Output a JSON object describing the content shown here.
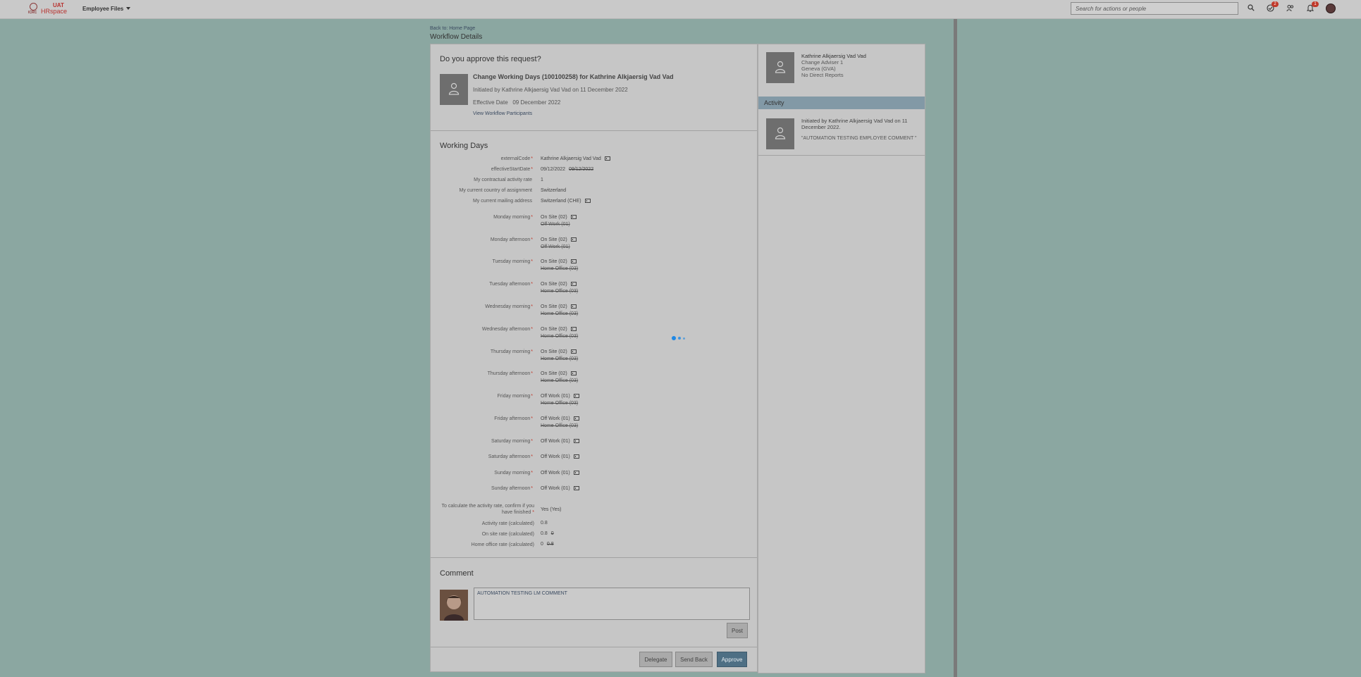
{
  "header": {
    "logo_uat": "UAT",
    "logo_hr": "HRspace",
    "logo_icrc": "ICRC",
    "module": "Employee Files",
    "search_placeholder": "Search for actions or people",
    "todo_badge": "2",
    "notif_badge": "1",
    "icons": [
      "search-icon",
      "todo-icon",
      "people-icon",
      "bell-icon",
      "avatar"
    ]
  },
  "nav": {
    "back": "Back to: Home Page",
    "page_title": "Workflow Details"
  },
  "request": {
    "question": "Do you approve this request?",
    "title": "Change Working Days (100100258) for Kathrine Alkjaersig Vad Vad",
    "initiated": "Initiated by Kathrine Alkjaersig Vad Vad on 11 December 2022",
    "effective_label": "Effective Date",
    "effective_date": "09 December 2022",
    "participants_link": "View Workflow Participants"
  },
  "working_days": {
    "section_title": "Working Days",
    "top_fields": [
      {
        "label": "externalCode",
        "required": "*",
        "value": "Kathrine Alkjaersig Vad Vad",
        "old": "",
        "history": true
      },
      {
        "label": "effectiveStartDate",
        "required": "*",
        "value": "09/12/2022",
        "old": "09/12/2022",
        "history": false
      },
      {
        "label": "My contractual activity rate",
        "required": "",
        "value": "1",
        "old": "",
        "history": false
      },
      {
        "label": "My current country of assignment",
        "required": "",
        "value": "Switzerland",
        "old": "",
        "history": false
      },
      {
        "label": "My current mailing address",
        "required": "",
        "value": "Switzerland (CHE)",
        "old": "",
        "history": true
      }
    ],
    "day_fields": [
      {
        "label": "Monday morning",
        "required": "*",
        "value": "On Site (02)",
        "old": "Off Work (01)"
      },
      {
        "label": "Monday afternoon",
        "required": "*",
        "value": "On Site (02)",
        "old": "Off Work (01)"
      },
      {
        "label": "Tuesday morning",
        "required": "*",
        "value": "On Site (02)",
        "old": "Home Office (03)"
      },
      {
        "label": "Tuesday afternoon",
        "required": "*",
        "value": "On Site (02)",
        "old": "Home Office (03)"
      },
      {
        "label": "Wednesday morning",
        "required": "*",
        "value": "On Site (02)",
        "old": "Home Office (03)"
      },
      {
        "label": "Wednesday afternoon",
        "required": "*",
        "value": "On Site (02)",
        "old": "Home Office (03)"
      },
      {
        "label": "Thursday morning",
        "required": "*",
        "value": "On Site (02)",
        "old": "Home Office (03)"
      },
      {
        "label": "Thursday afternoon",
        "required": "*",
        "value": "On Site (02)",
        "old": "Home Office (03)"
      },
      {
        "label": "Friday morning",
        "required": "*",
        "value": "Off Work (01)",
        "old": "Home Office (03)"
      },
      {
        "label": "Friday afternoon",
        "required": "*",
        "value": "Off Work (01)",
        "old": "Home Office (03)"
      }
    ],
    "weekend_fields": [
      {
        "label": "Saturday morning",
        "required": "*",
        "value": "Off Work (01)"
      },
      {
        "label": "Saturday afternoon",
        "required": "*",
        "value": "Off Work (01)"
      },
      {
        "label": "Sunday morning",
        "required": "*",
        "value": "Off Work (01)"
      },
      {
        "label": "Sunday afternoon",
        "required": "*",
        "value": "Off Work (01)"
      }
    ],
    "confirm_label": "To calculate the activity rate, confirm if you have finished",
    "confirm_required": "*",
    "confirm_value": "Yes (Yes)",
    "rates": [
      {
        "label": "Activity rate (calculated)",
        "value": "0.8",
        "old": ""
      },
      {
        "label": "On site rate (calculated)",
        "value": "0.8",
        "old": "0"
      },
      {
        "label": "Home office rate (calculated)",
        "value": "0",
        "old": "0.8"
      }
    ]
  },
  "comment": {
    "section_title": "Comment",
    "text": "AUTOMATION TESTING LM COMMENT",
    "post": "Post"
  },
  "actions": {
    "delegate": "Delegate",
    "send_back": "Send Back",
    "approve": "Approve"
  },
  "side": {
    "name": "Kathrine Alkjaersig Vad Vad",
    "role": "Change Adviser 1",
    "location": "Geneva (GVA)",
    "reports": "No Direct Reports",
    "activity_title": "Activity",
    "activity_text": "Initiated by Kathrine Alkjaersig Vad Vad on 11 December 2022.",
    "activity_comment": "\"AUTOMATION TESTING EMPLOYEE COMMENT \""
  },
  "colors": {
    "page_bg": "#8ba7a1",
    "approve": "#4e6f84",
    "required": "#c0392b",
    "spinner": "#1e88e5"
  }
}
